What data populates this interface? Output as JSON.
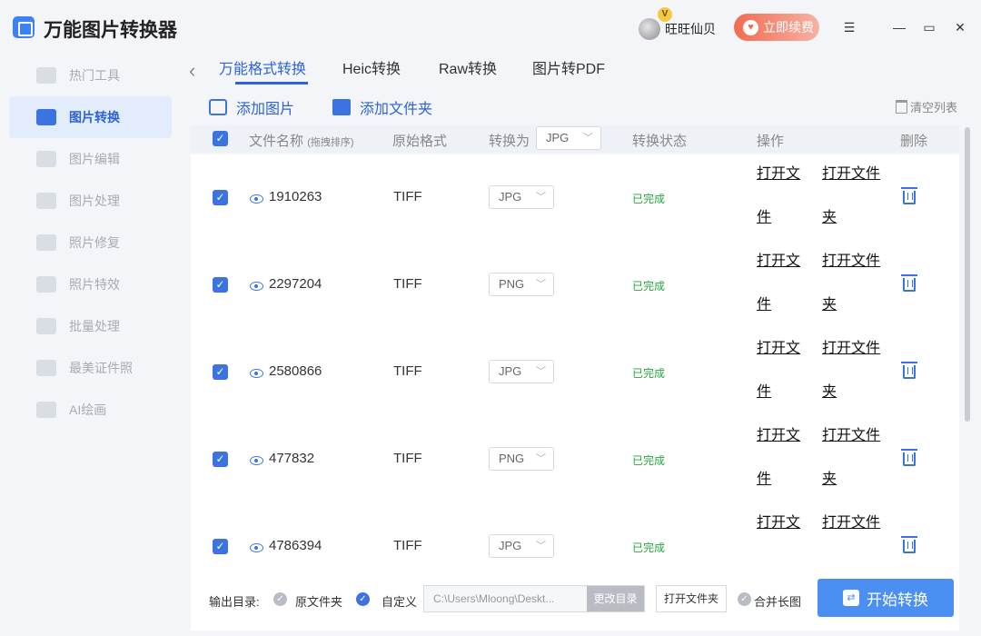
{
  "app": {
    "title": "万能图片转换器"
  },
  "user": {
    "badge": "V",
    "name": "旺旺仙贝",
    "renew_label": "立即续费"
  },
  "window": {
    "menu_icon": "☰",
    "min_icon": "—",
    "max_icon": "▭",
    "close_icon": "✕"
  },
  "sidebar": {
    "items": [
      {
        "label": "热门工具",
        "icon": "grid-icon"
      },
      {
        "label": "图片转换",
        "icon": "image-convert-icon"
      },
      {
        "label": "图片编辑",
        "icon": "image-edit-icon"
      },
      {
        "label": "图片处理",
        "icon": "image-process-icon"
      },
      {
        "label": "照片修复",
        "icon": "photo-repair-icon"
      },
      {
        "label": "照片特效",
        "icon": "photo-effect-icon"
      },
      {
        "label": "批量处理",
        "icon": "batch-icon"
      },
      {
        "label": "最美证件照",
        "icon": "id-photo-icon"
      },
      {
        "label": "AI绘画",
        "icon": "ai-paint-icon"
      }
    ]
  },
  "tabs": [
    {
      "label": "万能格式转换"
    },
    {
      "label": "Heic转换"
    },
    {
      "label": "Raw转换"
    },
    {
      "label": "图片转PDF"
    }
  ],
  "toolbar": {
    "add_image": "添加图片",
    "add_folder": "添加文件夹",
    "clear_list": "清空列表"
  },
  "table": {
    "headers": {
      "name": "文件名称",
      "name_hint": "(拖拽排序)",
      "format": "原始格式",
      "convert_to": "转换为",
      "convert_to_value": "JPG",
      "status": "转换状态",
      "action": "操作",
      "delete": "删除"
    },
    "rows": [
      {
        "name": "1910263",
        "format": "TIFF",
        "target": "JPG",
        "status": "已完成",
        "open_file_1": "打开文",
        "open_file_2": "件",
        "open_folder_1": "打开文件",
        "open_folder_2": "夹"
      },
      {
        "name": "2297204",
        "format": "TIFF",
        "target": "PNG",
        "status": "已完成",
        "open_file_1": "打开文",
        "open_file_2": "件",
        "open_folder_1": "打开文件",
        "open_folder_2": "夹"
      },
      {
        "name": "2580866",
        "format": "TIFF",
        "target": "JPG",
        "status": "已完成",
        "open_file_1": "打开文",
        "open_file_2": "件",
        "open_folder_1": "打开文件",
        "open_folder_2": "夹"
      },
      {
        "name": "477832",
        "format": "TIFF",
        "target": "PNG",
        "status": "已完成",
        "open_file_1": "打开文",
        "open_file_2": "件",
        "open_folder_1": "打开文件",
        "open_folder_2": "夹"
      },
      {
        "name": "4786394",
        "format": "TIFF",
        "target": "JPG",
        "status": "已完成",
        "open_file_1": "打开文",
        "open_file_2": "",
        "open_folder_1": "打开文件",
        "open_folder_2": ""
      }
    ]
  },
  "footer": {
    "output_label": "输出目录:",
    "original_folder": "原文件夹",
    "custom": "自定义",
    "path": "C:\\Users\\Mloong\\Deskt...",
    "change_dir": "更改目录",
    "open_folder": "打开文件夹",
    "merge": "合并长图",
    "start": "开始转换"
  },
  "colors": {
    "accent": "#3b74e0",
    "done": "#27a33f",
    "renew": "#f26c4f"
  }
}
